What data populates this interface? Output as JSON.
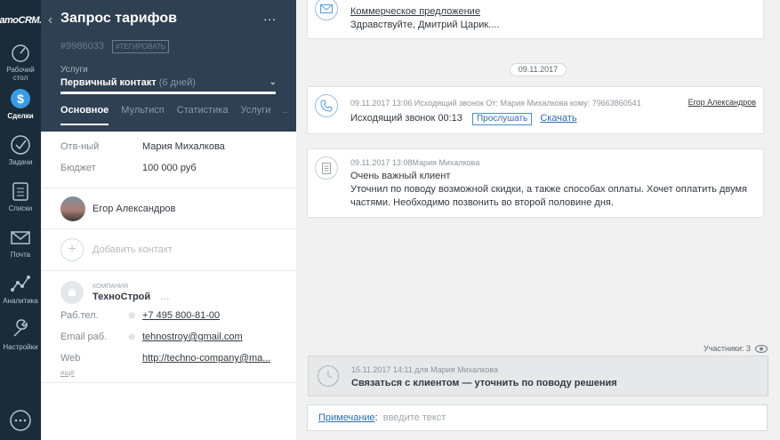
{
  "nav": {
    "logo": "amoCRM.",
    "items": [
      {
        "label": "Рабочий стол",
        "icon": "dashboard-icon"
      },
      {
        "label": "Сделки",
        "icon": "deals-icon",
        "active": true
      },
      {
        "label": "Задачи",
        "icon": "tasks-icon"
      },
      {
        "label": "Списки",
        "icon": "lists-icon"
      },
      {
        "label": "Почта",
        "icon": "mail-icon"
      },
      {
        "label": "Аналитика",
        "icon": "analytics-icon"
      },
      {
        "label": "Настройки",
        "icon": "settings-icon"
      }
    ],
    "chat_icon": "chat-icon"
  },
  "lead": {
    "title": "Запрос тарифов",
    "more": "...",
    "id": "#9986033",
    "tag_button": "#ТЕГИРОВАТЬ",
    "pipeline_label": "Услуги",
    "stage": "Первичный контакт",
    "stage_days": "(6 дней)",
    "stage_progress": 1.0,
    "tabs": [
      "Основное",
      "Мультисп",
      "Статистика",
      "Услуги"
    ],
    "tabs_more": "...",
    "fields": [
      {
        "label": "Отв-ный",
        "value": "Мария Михалкова"
      },
      {
        "label": "Бюджет",
        "value": "100 000 руб"
      }
    ],
    "contact_name": "Егор Александров",
    "add_contact": "Добавить контакт",
    "company": {
      "type": "КОМПАНИЯ",
      "name": "ТехноСтрой",
      "dots": "...",
      "rows": [
        {
          "label": "Раб.тел.",
          "value": "+7 495 800-81-00"
        },
        {
          "label": "Email раб.",
          "value": "tehnostroy@gmail.com"
        },
        {
          "label": "Web",
          "value": "http://techno-company@ma..."
        }
      ],
      "more": "ещё"
    }
  },
  "feed": {
    "email": {
      "subject": "Коммерческое предложение",
      "text": "Здравствуйте, Дмитрий Царик...."
    },
    "date_separator": "09.11.2017",
    "call": {
      "meta": "09.11.2017 13:06 Исходящий звонок От: Мария Михалкова  кому: 79663860541",
      "author_link": "Егор Александров",
      "text": "Исходящий звонок 00:13",
      "listen": "Прослушать",
      "download": "Скачать"
    },
    "note": {
      "meta": "09.11.2017 13:08Мария Михалкова",
      "title": "Очень важный клиент",
      "body": "Уточнил по поводу возможной скидки, а также способах оплаты. Хочет оплатить двумя частями. Необходимо позвонить во второй половине дня."
    },
    "participants": "Участники: 3",
    "task": {
      "meta": "15.11.2017 14:11 для Мария Михалкова",
      "title": "Связаться с клиентом — уточнить по поводу решения"
    },
    "composer": {
      "kind": "Примечание",
      "colon": ":",
      "placeholder": "введите текст"
    }
  }
}
